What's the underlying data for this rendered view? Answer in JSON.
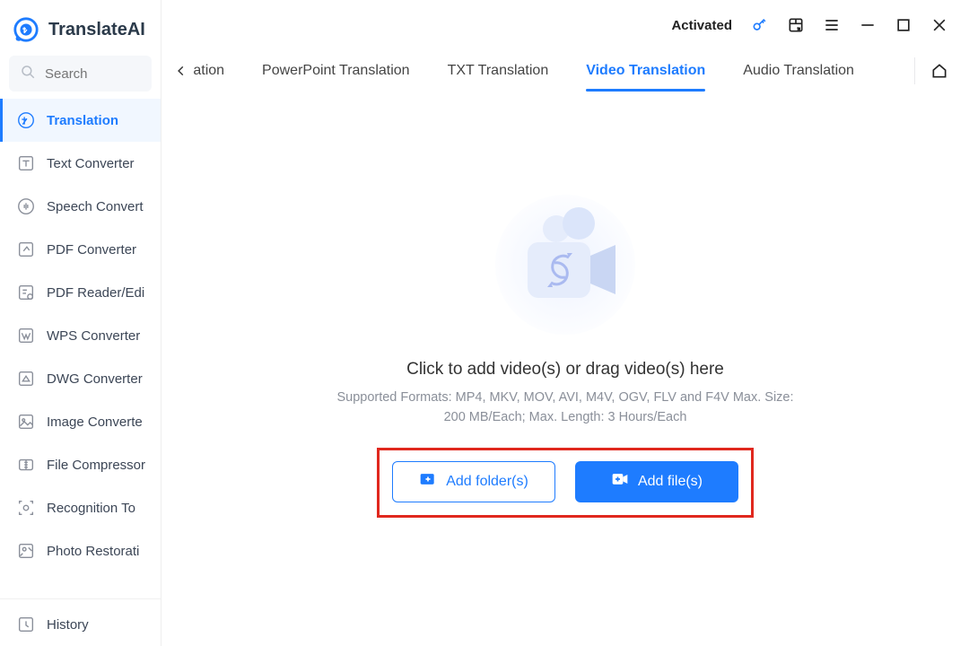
{
  "brand": {
    "name": "TranslateAI"
  },
  "search": {
    "placeholder": "Search"
  },
  "topbar": {
    "status": "Activated"
  },
  "sidebar": {
    "items": [
      {
        "label": "Translation"
      },
      {
        "label": "Text Converter"
      },
      {
        "label": "Speech Convert"
      },
      {
        "label": "PDF Converter"
      },
      {
        "label": "PDF Reader/Edi"
      },
      {
        "label": "WPS Converter"
      },
      {
        "label": "DWG Converter"
      },
      {
        "label": "Image Converte"
      },
      {
        "label": "File Compressor"
      },
      {
        "label": "Recognition To"
      },
      {
        "label": "Photo Restorati"
      }
    ],
    "history": {
      "label": "History"
    }
  },
  "tabs": {
    "items": [
      {
        "label": "anslation"
      },
      {
        "label": "PowerPoint Translation"
      },
      {
        "label": "TXT Translation"
      },
      {
        "label": "Video Translation"
      },
      {
        "label": "Audio Translation"
      }
    ]
  },
  "drop": {
    "title": "Click to add video(s) or drag video(s) here",
    "sub": "Supported Formats: MP4, MKV, MOV, AVI, M4V, OGV, FLV and F4V Max. Size: 200 MB/Each; Max. Length: 3 Hours/Each",
    "add_folder": "Add folder(s)",
    "add_file": "Add file(s)"
  }
}
